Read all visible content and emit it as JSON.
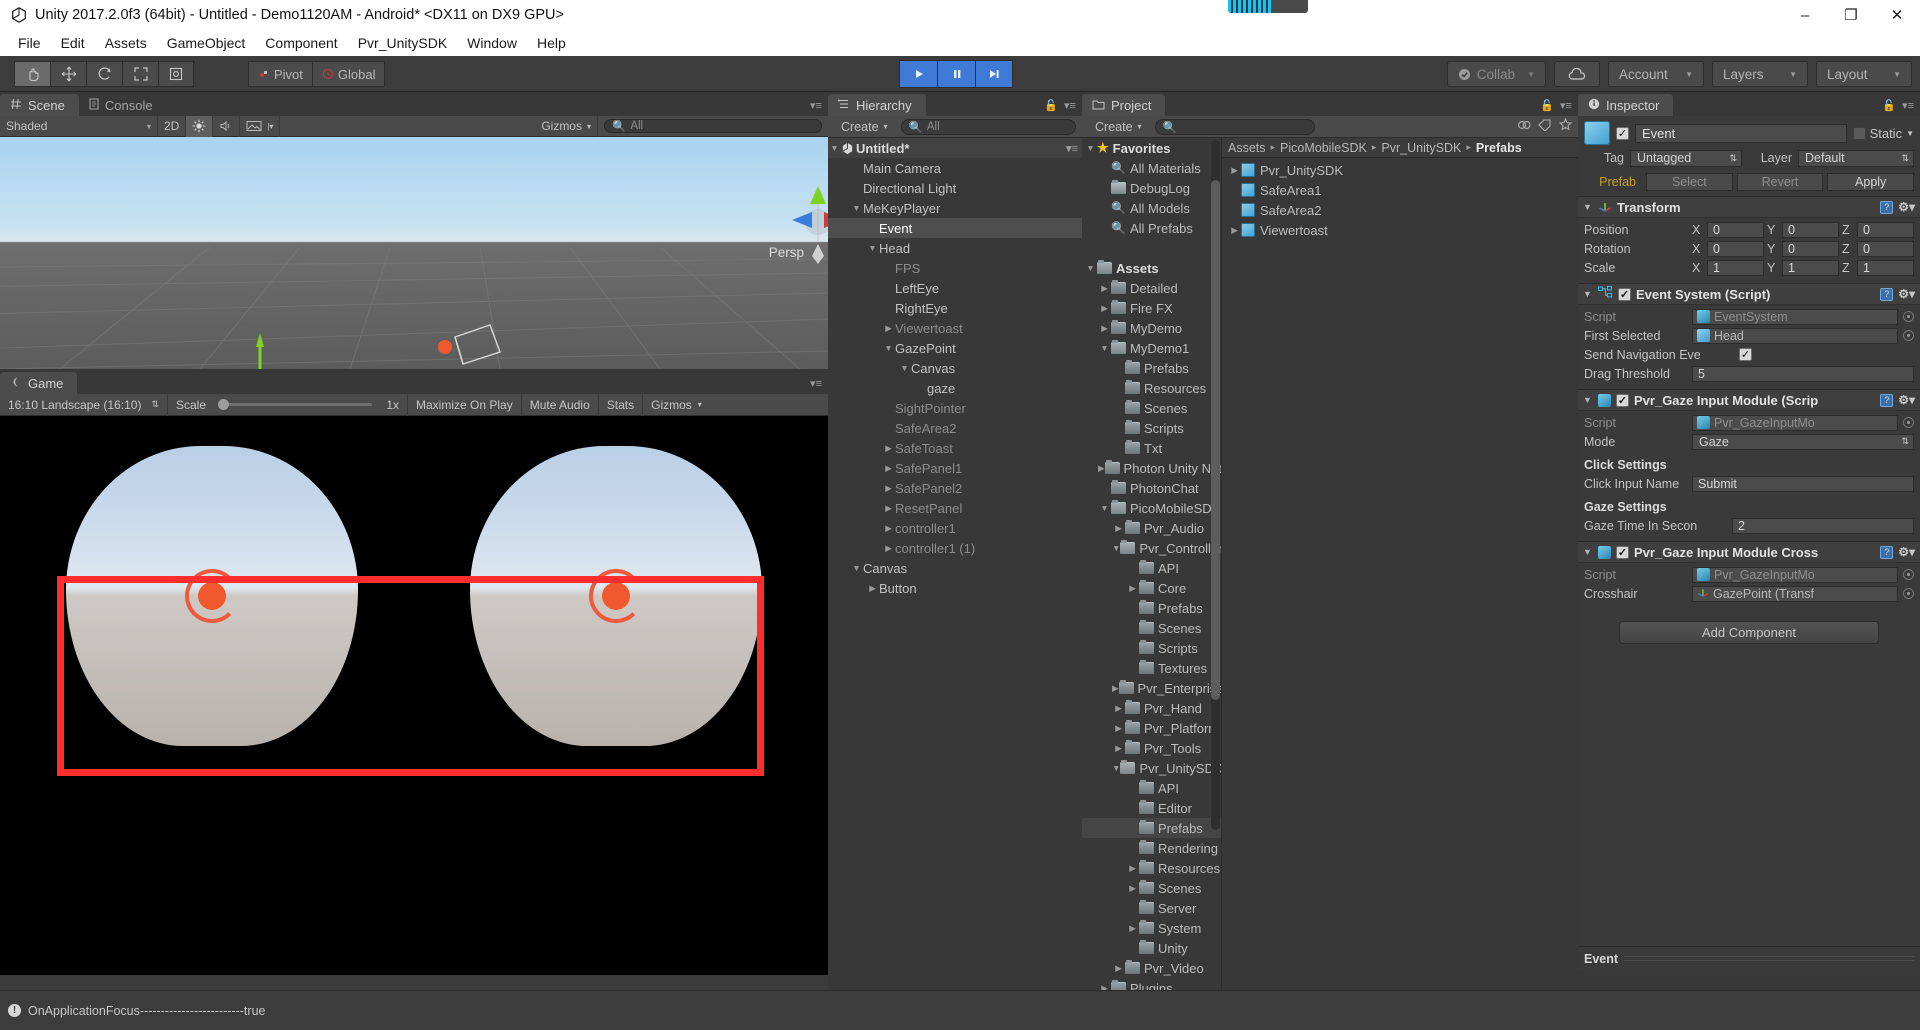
{
  "window": {
    "title": "Unity 2017.2.0f3 (64bit) - Untitled - Demo1120AM - Android* <DX11 on DX9 GPU>",
    "minimize": "–",
    "maximize": "❐",
    "close": "✕"
  },
  "menu": [
    "File",
    "Edit",
    "Assets",
    "GameObject",
    "Component",
    "Pvr_UnitySDK",
    "Window",
    "Help"
  ],
  "toolbar": {
    "tools": [
      "hand-tool",
      "move-tool",
      "rotate-tool",
      "scale-tool",
      "rect-tool"
    ],
    "pivot_label": "Pivot",
    "global_label": "Global",
    "play_label": "play-button",
    "pause_label": "pause-button",
    "step_label": "step-button",
    "collab_label": "Collab",
    "cloud_label": "cloud-icon",
    "account_label": "Account",
    "layers_label": "Layers",
    "layout_label": "Layout"
  },
  "scene_panel": {
    "tabs": [
      {
        "label": "Scene",
        "active": true
      },
      {
        "label": "Console",
        "active": false
      }
    ],
    "shading": "Shaded",
    "mode_2d": "2D",
    "gizmos_label": "Gizmos",
    "search_placeholder": "All",
    "persp_label": "Persp"
  },
  "game_panel": {
    "tab": "Game",
    "aspect": "16:10 Landscape (16:10)",
    "scale_label": "Scale",
    "scale_value": "1x",
    "maximize_on_play": "Maximize On Play",
    "mute_audio": "Mute Audio",
    "stats": "Stats",
    "gizmos": "Gizmos"
  },
  "hierarchy": {
    "tab": "Hierarchy",
    "create_label": "Create",
    "search_placeholder": "All",
    "scene_name": "Untitled*",
    "items": [
      {
        "label": "Main Camera",
        "indent": 1,
        "arrow": "none",
        "dim": false,
        "selected": false
      },
      {
        "label": "Directional Light",
        "indent": 1,
        "arrow": "none",
        "dim": false,
        "selected": false
      },
      {
        "label": "MeKeyPlayer",
        "indent": 1,
        "arrow": "down",
        "dim": false,
        "selected": false
      },
      {
        "label": "Event",
        "indent": 2,
        "arrow": "none",
        "dim": false,
        "selected": true
      },
      {
        "label": "Head",
        "indent": 2,
        "arrow": "down",
        "dim": false,
        "selected": false
      },
      {
        "label": "FPS",
        "indent": 3,
        "arrow": "none",
        "dim": true,
        "selected": false
      },
      {
        "label": "LeftEye",
        "indent": 3,
        "arrow": "none",
        "dim": false,
        "selected": false
      },
      {
        "label": "RightEye",
        "indent": 3,
        "arrow": "none",
        "dim": false,
        "selected": false
      },
      {
        "label": "Viewertoast",
        "indent": 3,
        "arrow": "right",
        "dim": true,
        "selected": false
      },
      {
        "label": "GazePoint",
        "indent": 3,
        "arrow": "down",
        "dim": false,
        "selected": false
      },
      {
        "label": "Canvas",
        "indent": 4,
        "arrow": "down",
        "dim": false,
        "selected": false
      },
      {
        "label": "gaze",
        "indent": 5,
        "arrow": "none",
        "dim": false,
        "selected": false
      },
      {
        "label": "SightPointer",
        "indent": 3,
        "arrow": "none",
        "dim": true,
        "selected": false
      },
      {
        "label": "SafeArea2",
        "indent": 3,
        "arrow": "none",
        "dim": true,
        "selected": false
      },
      {
        "label": "SafeToast",
        "indent": 3,
        "arrow": "right",
        "dim": true,
        "selected": false
      },
      {
        "label": "SafePanel1",
        "indent": 3,
        "arrow": "right",
        "dim": true,
        "selected": false
      },
      {
        "label": "SafePanel2",
        "indent": 3,
        "arrow": "right",
        "dim": true,
        "selected": false
      },
      {
        "label": "ResetPanel",
        "indent": 3,
        "arrow": "right",
        "dim": true,
        "selected": false
      },
      {
        "label": "controller1",
        "indent": 3,
        "arrow": "right",
        "dim": true,
        "selected": false
      },
      {
        "label": "controller1 (1)",
        "indent": 3,
        "arrow": "right",
        "dim": true,
        "selected": false
      },
      {
        "label": "Canvas",
        "indent": 1,
        "arrow": "down",
        "dim": false,
        "selected": false
      },
      {
        "label": "Button",
        "indent": 2,
        "arrow": "right",
        "dim": false,
        "selected": false
      }
    ]
  },
  "project": {
    "tab": "Project",
    "create_label": "Create",
    "search_placeholder": "",
    "tree": [
      {
        "label": "Favorites",
        "indent": 0,
        "arrow": "down",
        "icon": "star",
        "bold": true,
        "sel": false
      },
      {
        "label": "All Materials",
        "indent": 1,
        "arrow": "none",
        "icon": "search",
        "bold": false,
        "sel": false
      },
      {
        "label": "DebugLog",
        "indent": 1,
        "arrow": "none",
        "icon": "favfolder",
        "bold": false,
        "sel": false
      },
      {
        "label": "All Models",
        "indent": 1,
        "arrow": "none",
        "icon": "search",
        "bold": false,
        "sel": false
      },
      {
        "label": "All Prefabs",
        "indent": 1,
        "arrow": "none",
        "icon": "search",
        "bold": false,
        "sel": false
      },
      {
        "label": "",
        "indent": 0,
        "arrow": "none",
        "icon": "none",
        "bold": false,
        "sel": false
      },
      {
        "label": "Assets",
        "indent": 0,
        "arrow": "down",
        "icon": "folder",
        "bold": true,
        "sel": false
      },
      {
        "label": "Detailed",
        "indent": 1,
        "arrow": "right",
        "icon": "folder",
        "bold": false,
        "sel": false
      },
      {
        "label": "Fire FX",
        "indent": 1,
        "arrow": "right",
        "icon": "folder",
        "bold": false,
        "sel": false
      },
      {
        "label": "MyDemo",
        "indent": 1,
        "arrow": "right",
        "icon": "folder",
        "bold": false,
        "sel": false
      },
      {
        "label": "MyDemo1",
        "indent": 1,
        "arrow": "down",
        "icon": "folder",
        "bold": false,
        "sel": false
      },
      {
        "label": "Prefabs",
        "indent": 2,
        "arrow": "none",
        "icon": "folder",
        "bold": false,
        "sel": false
      },
      {
        "label": "Resources",
        "indent": 2,
        "arrow": "none",
        "icon": "folder",
        "bold": false,
        "sel": false
      },
      {
        "label": "Scenes",
        "indent": 2,
        "arrow": "none",
        "icon": "folder",
        "bold": false,
        "sel": false
      },
      {
        "label": "Scripts",
        "indent": 2,
        "arrow": "none",
        "icon": "folder",
        "bold": false,
        "sel": false
      },
      {
        "label": "Txt",
        "indent": 2,
        "arrow": "none",
        "icon": "folder",
        "bold": false,
        "sel": false
      },
      {
        "label": "Photon Unity Networking",
        "indent": 1,
        "arrow": "right",
        "icon": "folder",
        "bold": false,
        "sel": false
      },
      {
        "label": "PhotonChat",
        "indent": 1,
        "arrow": "none",
        "icon": "folder",
        "bold": false,
        "sel": false
      },
      {
        "label": "PicoMobileSDK",
        "indent": 1,
        "arrow": "down",
        "icon": "folder",
        "bold": false,
        "sel": false
      },
      {
        "label": "Pvr_Audio",
        "indent": 2,
        "arrow": "right",
        "icon": "folder",
        "bold": false,
        "sel": false
      },
      {
        "label": "Pvr_Controller",
        "indent": 2,
        "arrow": "down",
        "icon": "folder",
        "bold": false,
        "sel": false
      },
      {
        "label": "API",
        "indent": 3,
        "arrow": "none",
        "icon": "folder",
        "bold": false,
        "sel": false
      },
      {
        "label": "Core",
        "indent": 3,
        "arrow": "right",
        "icon": "folder",
        "bold": false,
        "sel": false
      },
      {
        "label": "Prefabs",
        "indent": 3,
        "arrow": "none",
        "icon": "folder",
        "bold": false,
        "sel": false
      },
      {
        "label": "Scenes",
        "indent": 3,
        "arrow": "none",
        "icon": "folder",
        "bold": false,
        "sel": false
      },
      {
        "label": "Scripts",
        "indent": 3,
        "arrow": "none",
        "icon": "folder",
        "bold": false,
        "sel": false
      },
      {
        "label": "Textures",
        "indent": 3,
        "arrow": "none",
        "icon": "folder",
        "bold": false,
        "sel": false
      },
      {
        "label": "Pvr_Enterprise",
        "indent": 2,
        "arrow": "right",
        "icon": "folder",
        "bold": false,
        "sel": false
      },
      {
        "label": "Pvr_Hand",
        "indent": 2,
        "arrow": "right",
        "icon": "folder",
        "bold": false,
        "sel": false
      },
      {
        "label": "Pvr_Platform",
        "indent": 2,
        "arrow": "right",
        "icon": "folder",
        "bold": false,
        "sel": false
      },
      {
        "label": "Pvr_Tools",
        "indent": 2,
        "arrow": "right",
        "icon": "folder",
        "bold": false,
        "sel": false
      },
      {
        "label": "Pvr_UnitySDK",
        "indent": 2,
        "arrow": "down",
        "icon": "folder",
        "bold": false,
        "sel": false
      },
      {
        "label": "API",
        "indent": 3,
        "arrow": "none",
        "icon": "folder",
        "bold": false,
        "sel": false
      },
      {
        "label": "Editor",
        "indent": 3,
        "arrow": "none",
        "icon": "folder",
        "bold": false,
        "sel": false
      },
      {
        "label": "Prefabs",
        "indent": 3,
        "arrow": "none",
        "icon": "folder",
        "bold": false,
        "sel": true
      },
      {
        "label": "Rendering",
        "indent": 3,
        "arrow": "none",
        "icon": "folder",
        "bold": false,
        "sel": false
      },
      {
        "label": "Resources",
        "indent": 3,
        "arrow": "right",
        "icon": "folder",
        "bold": false,
        "sel": false
      },
      {
        "label": "Scenes",
        "indent": 3,
        "arrow": "right",
        "icon": "folder",
        "bold": false,
        "sel": false
      },
      {
        "label": "Server",
        "indent": 3,
        "arrow": "none",
        "icon": "folder",
        "bold": false,
        "sel": false
      },
      {
        "label": "System",
        "indent": 3,
        "arrow": "right",
        "icon": "folder",
        "bold": false,
        "sel": false
      },
      {
        "label": "Unity",
        "indent": 3,
        "arrow": "none",
        "icon": "folder",
        "bold": false,
        "sel": false
      },
      {
        "label": "Pvr_Video",
        "indent": 2,
        "arrow": "right",
        "icon": "folder",
        "bold": false,
        "sel": false
      },
      {
        "label": "Plugins",
        "indent": 1,
        "arrow": "right",
        "icon": "folder",
        "bold": false,
        "sel": false
      }
    ],
    "breadcrumb": [
      "Assets",
      "PicoMobileSDK",
      "Pvr_UnitySDK",
      "Prefabs"
    ],
    "contents": [
      {
        "label": "Pvr_UnitySDK",
        "arrow": "right"
      },
      {
        "label": "SafeArea1",
        "arrow": "none"
      },
      {
        "label": "SafeArea2",
        "arrow": "none"
      },
      {
        "label": "Viewertoast",
        "arrow": "right"
      }
    ]
  },
  "inspector": {
    "tab": "Inspector",
    "object_name": "Event",
    "enabled": true,
    "static_label": "Static",
    "static_checked": false,
    "tag_label": "Tag",
    "tag_value": "Untagged",
    "layer_label": "Layer",
    "layer_value": "Default",
    "prefab_label": "Prefab",
    "prefab_buttons": [
      "Select",
      "Revert",
      "Apply"
    ],
    "transform": {
      "title": "Transform",
      "rows": [
        {
          "label": "Position",
          "x": "0",
          "y": "0",
          "z": "0"
        },
        {
          "label": "Rotation",
          "x": "0",
          "y": "0",
          "z": "0"
        },
        {
          "label": "Scale",
          "x": "1",
          "y": "1",
          "z": "1"
        }
      ]
    },
    "event_system": {
      "title": "Event System (Script)",
      "checked": true,
      "script_label": "Script",
      "script_value": "EventSystem",
      "first_selected_label": "First Selected",
      "first_selected_value": "Head",
      "send_nav_label": "Send Navigation Eve",
      "send_nav_checked": true,
      "drag_threshold_label": "Drag Threshold",
      "drag_threshold_value": "5"
    },
    "gaze_module": {
      "title": "Pvr_Gaze Input Module (Scrip",
      "checked": true,
      "script_label": "Script",
      "script_value": "Pvr_GazeInputMo",
      "mode_label": "Mode",
      "mode_value": "Gaze",
      "click_settings_title": "Click Settings",
      "click_input_label": "Click Input Name",
      "click_input_value": "Submit",
      "gaze_settings_title": "Gaze Settings",
      "gaze_time_label": "Gaze Time In Secon",
      "gaze_time_value": "2"
    },
    "gaze_crosshair": {
      "title": "Pvr_Gaze Input Module Cross",
      "checked": true,
      "script_label": "Script",
      "script_value": "Pvr_GazeInputMo",
      "crosshair_label": "Crosshair",
      "crosshair_value": "GazePoint (Transf"
    },
    "add_component": "Add Component",
    "footer_name": "Event"
  },
  "statusbar": {
    "message": "OnApplicationFocus-------------------------true"
  },
  "colors": {
    "accent_blue": "#3e7ad6",
    "red_highlight": "#ff2d2d",
    "panel_bg": "#383838",
    "toolbar_bg": "#3c3c3c",
    "gaze_orange": "#f0592e"
  }
}
